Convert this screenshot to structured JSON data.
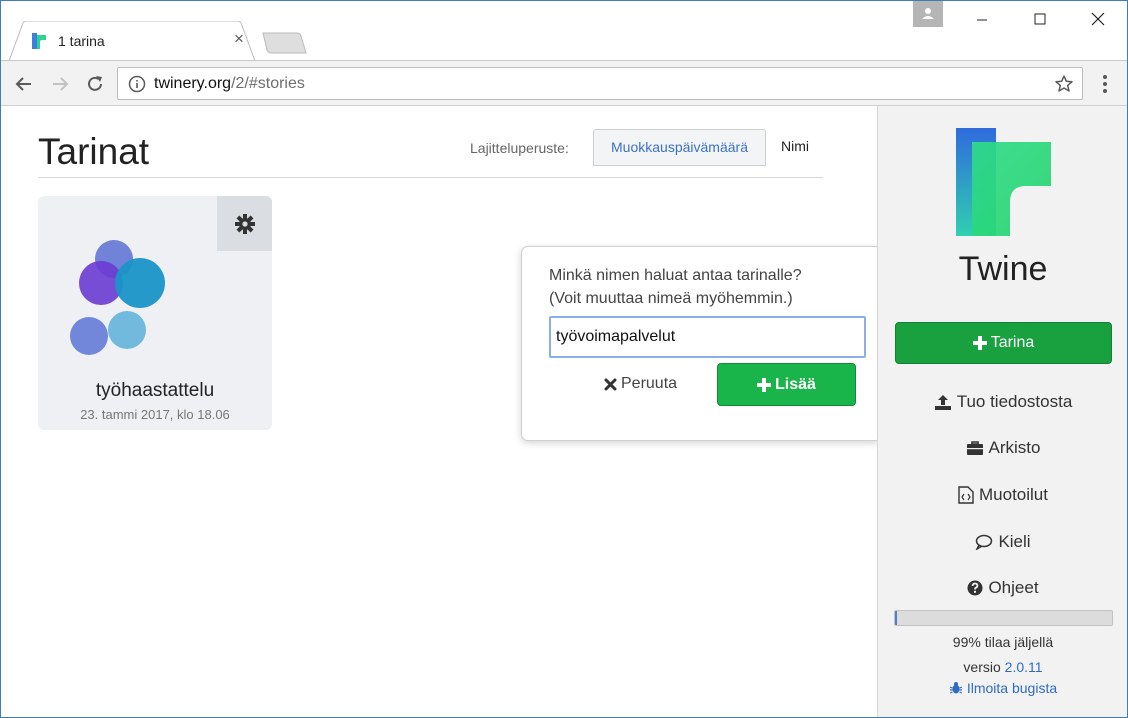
{
  "browser": {
    "tab_title": "1 tarina",
    "tab_close": "×",
    "url_host": "twinery.org",
    "url_path": "/2/#stories"
  },
  "main": {
    "title": "Tarinat",
    "sort_label": "Lajitteluperuste:",
    "sort_options": [
      "Muokkauspäivämäärä",
      "Nimi"
    ],
    "sort_selected": "Muokkauspäivämäärä"
  },
  "story": {
    "name": "työhaastattelu",
    "date": "23. tammi 2017, klo 18.06"
  },
  "dialog": {
    "question_line1": "Minkä nimen haluat antaa tarinalle?",
    "question_line2": "(Voit muuttaa nimeä myöhemmin.)",
    "input_value": "työvoimapalvelut",
    "cancel_label": "Peruuta",
    "add_label": "Lisää"
  },
  "sidebar": {
    "brand": "Twine",
    "new_story_label": "Tarina",
    "links": [
      {
        "label": "Tuo tiedostosta",
        "icon": "upload-icon"
      },
      {
        "label": "Arkisto",
        "icon": "briefcase-icon"
      },
      {
        "label": "Muotoilut",
        "icon": "code-file-icon"
      },
      {
        "label": "Kieli",
        "icon": "speech-bubble-icon"
      },
      {
        "label": "Ohjeet",
        "icon": "question-circle-icon"
      }
    ],
    "storage_remaining_percent": 99,
    "storage_text": "99% tilaa jäljellä",
    "version_prefix": "versio",
    "version_number": "2.0.11",
    "bug_label": "Ilmoita bugista"
  },
  "colors": {
    "accent_green": "#19b54a",
    "sidebar_green": "#19a13f",
    "link_blue": "#2f6bc4",
    "input_focus": "#8aaee6"
  }
}
